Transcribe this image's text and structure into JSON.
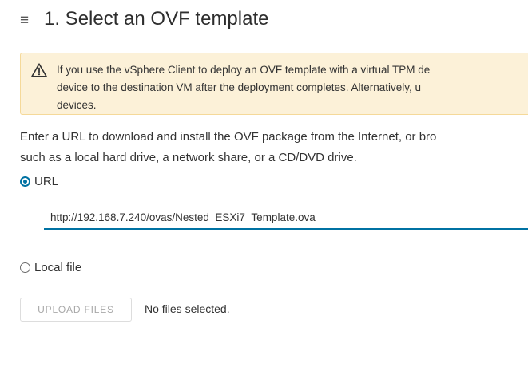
{
  "header": {
    "menu_icon": "hamburger-icon",
    "title": "1. Select an OVF template"
  },
  "alert": {
    "icon": "warning-icon",
    "lines": [
      "If you use the vSphere Client to deploy an OVF template with a virtual TPM de",
      "device to the destination VM after the deployment completes. Alternatively, u",
      "devices."
    ]
  },
  "description": {
    "lines": [
      "Enter a URL to download and install the OVF package from the Internet, or bro",
      "such as a local hard drive, a network share, or a CD/DVD drive."
    ]
  },
  "source": {
    "url_option": {
      "label": "URL",
      "selected": true
    },
    "url_input": {
      "value": "http://192.168.7.240/ovas/Nested_ESXi7_Template.ova"
    },
    "local_option": {
      "label": "Local file",
      "selected": false
    },
    "upload_button": {
      "label": "UPLOAD FILES"
    },
    "file_status": "No files selected."
  },
  "colors": {
    "accent": "#0072a3",
    "alert_background": "#fcf1d8",
    "alert_border": "#f5d999"
  }
}
